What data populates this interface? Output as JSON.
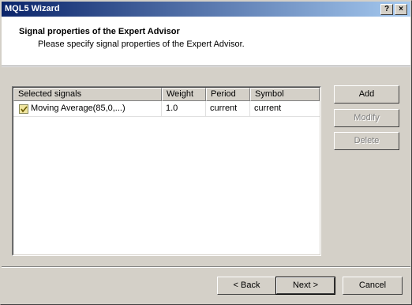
{
  "window": {
    "title": "MQL5 Wizard",
    "help_glyph": "?",
    "close_glyph": "×"
  },
  "header": {
    "title": "Signal properties of the Expert Advisor",
    "subtitle": "Please specify signal properties of the Expert Advisor."
  },
  "table": {
    "columns": [
      "Selected signals",
      "Weight",
      "Period",
      "Symbol"
    ],
    "rows": [
      {
        "checked": true,
        "signal": "Moving Average(85,0,...)",
        "weight": "1.0",
        "period": "current",
        "symbol": "current"
      }
    ]
  },
  "side_buttons": {
    "add": "Add",
    "modify": "Modify",
    "delete": "Delete"
  },
  "footer_buttons": {
    "back": "< Back",
    "next": "Next >",
    "cancel": "Cancel"
  }
}
